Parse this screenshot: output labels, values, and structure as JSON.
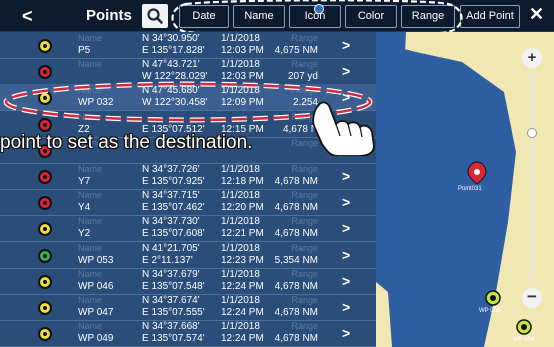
{
  "header": {
    "back_label": "<",
    "title": "Points",
    "tabs": [
      "Date",
      "Name",
      "Icon",
      "Color",
      "Range"
    ],
    "add_point": "Add Point",
    "close_label": "✕"
  },
  "labels": {
    "name": "Name",
    "range": "Range"
  },
  "rows": [
    {
      "name": "P5",
      "lat": "N 34°30.950'",
      "lon": "E 135°17.828'",
      "date": "1/1/2018",
      "time": "12:03 PM",
      "range": "4,675 NM",
      "icon_color": "#f4e03a"
    },
    {
      "name": "",
      "lat": "N 47°43.721'",
      "lon": "W 122°28.029'",
      "date": "1/1/2018",
      "time": "12:03 PM",
      "range": "207 yd",
      "icon_color": "#d9283a"
    },
    {
      "name": "WP 032",
      "lat": "N 47°45.680'",
      "lon": "W 122°30.458'",
      "date": "1/1/2018",
      "time": "12:09 PM",
      "range": "2.254",
      "icon_color": "#f4e03a"
    },
    {
      "name": "Z2",
      "lat": "",
      "lon": "E 135°07.512'",
      "date": "",
      "time": "12:15 PM",
      "range": "4,678 N",
      "icon_color": "#d9283a"
    },
    {
      "name": "",
      "lat": "",
      "lon": "",
      "date": "",
      "time": "",
      "range": "",
      "icon_color": "#d9283a"
    },
    {
      "name": "Y7",
      "lat": "N 34°37.726'",
      "lon": "E 135°07.925'",
      "date": "1/1/2018",
      "time": "12:18 PM",
      "range": "4,678 NM",
      "icon_color": "#d9283a"
    },
    {
      "name": "Y4",
      "lat": "N 34°37.715'",
      "lon": "E 135°07.462'",
      "date": "1/1/2018",
      "time": "12:20 PM",
      "range": "4,678 NM",
      "icon_color": "#d9283a"
    },
    {
      "name": "Y2",
      "lat": "N 34°37.730'",
      "lon": "E 135°07.608'",
      "date": "1/1/2018",
      "time": "12:21 PM",
      "range": "4,678 NM",
      "icon_color": "#f4e03a"
    },
    {
      "name": "WP 053",
      "lat": "N 41°21.705'",
      "lon": "E 2°11.137'",
      "date": "1/1/2018",
      "time": "12:23 PM",
      "range": "5,354 NM",
      "icon_color": "#3fb04a"
    },
    {
      "name": "WP 046",
      "lat": "N 34°37.679'",
      "lon": "E 135°07.548'",
      "date": "1/1/2018",
      "time": "12:24 PM",
      "range": "4,678 NM",
      "icon_color": "#f4e03a"
    },
    {
      "name": "WP 047",
      "lat": "N 34°37.674'",
      "lon": "E 135°07.555'",
      "date": "1/1/2018",
      "time": "12:24 PM",
      "range": "4,678 NM",
      "icon_color": "#f4e03a"
    },
    {
      "name": "WP 049",
      "lat": "N 34°37.668'",
      "lon": "E 135°07.574'",
      "date": "1/1/2018",
      "time": "12:24 PM",
      "range": "4,678 NM",
      "icon_color": "#f4e03a"
    }
  ],
  "map": {
    "points": [
      "Point031",
      "WP 055",
      "WP 054"
    ]
  },
  "caption": "point to set as the destination."
}
